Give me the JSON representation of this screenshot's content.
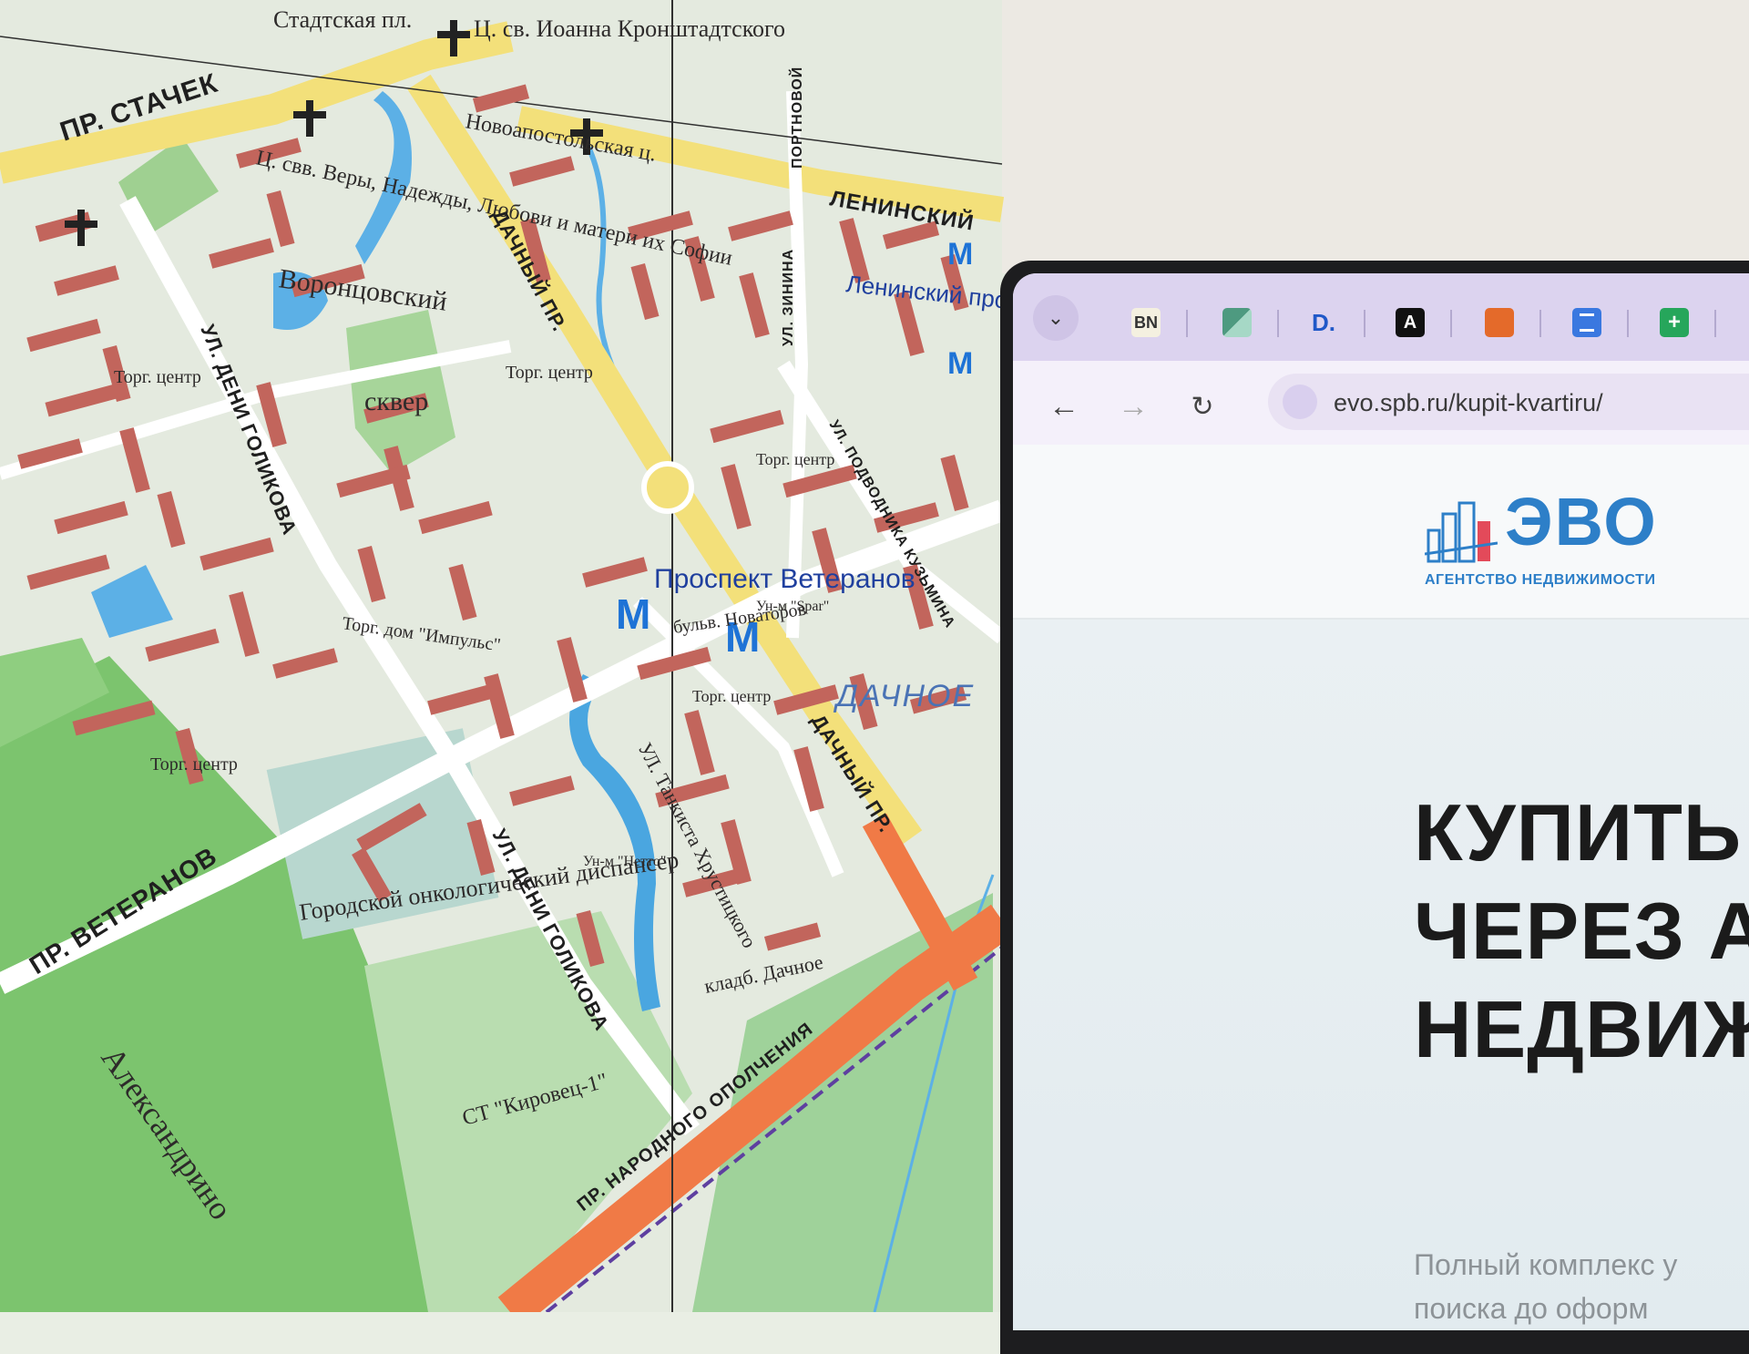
{
  "map": {
    "labels": {
      "square": "Стадтская пл.",
      "church_ioann": "Ц. св. Иоанна Кронштадтского",
      "stachek": "ПР. СТАЧЕК",
      "novoapostolskaya": "Новоапостольская ц.",
      "church_vera": "Ц. свв. Веры, Надежды, Любови и матери их Софии",
      "vorontsovsky": "Воронцовский",
      "skver": "сквер",
      "dachny_pr_1": "ДАЧНЫЙ ПР.",
      "dachny_pr_2": "ДАЧНЫЙ ПР.",
      "leninsky_street": "ЛЕНИНСКИЙ",
      "leninsky_metro": "Ленинский проспект",
      "veteranov_metro": "Проспект Ветеранов",
      "bulv_novatorov": "бульв. Новаторов",
      "dachnoe": "ДАЧНОЕ",
      "pr_veteranov": "ПР. ВЕТЕРАНОВ",
      "deni_golikova_1": "УЛ. ДЕНИ ГОЛИКОВА",
      "deni_golikova_2": "УЛ. ДЕНИ ГОЛИКОВА",
      "tankista": "УЛ. Танкиста Хрустицкого",
      "oncology": "Городской онкологический диспансер",
      "kladb": "кладб. Дачное",
      "kirovets": "СТ \"Кировец-1\"",
      "aleksandrino": "Александрино",
      "narodnogo_opolcheniya": "ПР. НАРОДНОГО ОПОЛЧЕНИЯ",
      "torg_center": "Торг. центр",
      "torg_dom": "Торг. дом \"Импульс\"",
      "un_spar": "Ун-м \"Spar\"",
      "un_netto": "Ун-м \"Нетто\"",
      "zinina": "УЛ. ЗИНИНА",
      "portovaya": "ПОРТНОВОЙ",
      "podvodnika": "УЛ. ПОДВОДНИКА КУЗЬМИНА"
    }
  },
  "browser": {
    "tabs": [
      {
        "name": "bn-favicon",
        "text": "BN"
      },
      {
        "name": "green-favicon",
        "text": ""
      },
      {
        "name": "d-favicon",
        "text": "D."
      },
      {
        "name": "a-favicon",
        "text": "A"
      },
      {
        "name": "orange-favicon",
        "text": ""
      },
      {
        "name": "docs-favicon",
        "text": ""
      },
      {
        "name": "sheets-favicon",
        "text": ""
      }
    ],
    "url": "evo.spb.ru/kupit-kvartiru/"
  },
  "site": {
    "logo_word": "ЭВО",
    "logo_sub": "АГЕНТСТВО НЕДВИЖИМОСТИ",
    "hero_lines": [
      "КУПИТЬ К",
      "ЧЕРЕЗ АГ",
      "НЕДВИЖ"
    ],
    "hero_sub": [
      "Полный комплекс у",
      "поиска до оформ"
    ]
  },
  "colors": {
    "map_bg": "#e6ece0",
    "building": "#c2655c",
    "park": "#7cc46e",
    "water": "#4aa6e0",
    "main_road": "#f3e07a",
    "brand": "#2d7fc8"
  }
}
